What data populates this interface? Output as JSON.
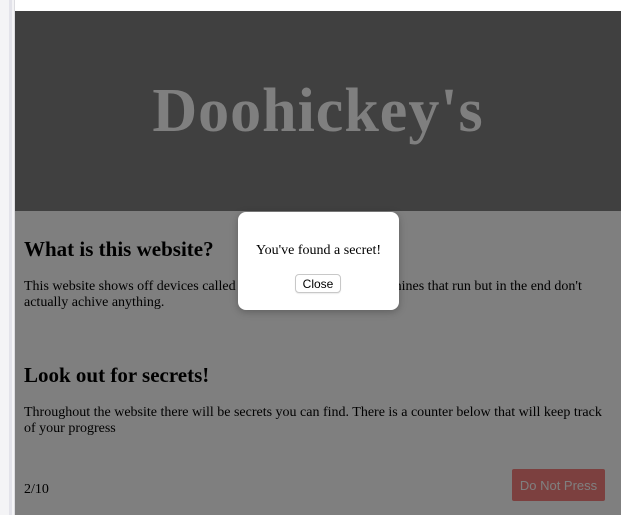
{
  "header": {
    "title": "Doohickey's"
  },
  "sections": [
    {
      "heading": "What is this website?",
      "text": "This website shows off devices called Doohickeys, which are machines that run but in the end don't actually achive anything."
    },
    {
      "heading": "Look out for secrets!",
      "text": "Throughout the website there will be secrets you can find. There is a counter below that will keep track of your progress"
    }
  ],
  "progress": {
    "counter_text": "2/10",
    "found": 2,
    "total": 10
  },
  "buttons": {
    "do_not_press_label": "Do Not Press"
  },
  "modal": {
    "message": "You've found a secret!",
    "close_label": "Close"
  },
  "colors": {
    "hero_background": "#808080",
    "hero_title": "#ffffff",
    "button_accent": "#f9817e",
    "overlay": "rgba(0,0,0,0.5)"
  }
}
